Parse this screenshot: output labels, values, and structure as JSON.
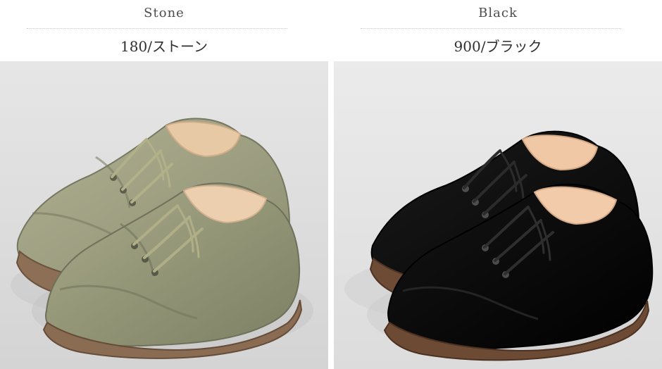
{
  "variants": [
    {
      "name": "Stone",
      "code": "180/ストーン",
      "image_name": "stone-shoes-image",
      "colors": {
        "background": "#d7d7d7",
        "upper": "#a0a283",
        "upper_shadow": "#7f8164",
        "lining": "#e7c8a5",
        "sole": "#7a6049",
        "lace": "#b0b089"
      }
    },
    {
      "name": "Black",
      "code": "900/ブラック",
      "image_name": "black-shoes-image",
      "colors": {
        "background": "#dcdcdc",
        "upper": "#111111",
        "upper_shadow": "#000000",
        "lining": "#efc7a6",
        "sole": "#6b4a34",
        "lace": "#2d2d2d"
      }
    }
  ]
}
